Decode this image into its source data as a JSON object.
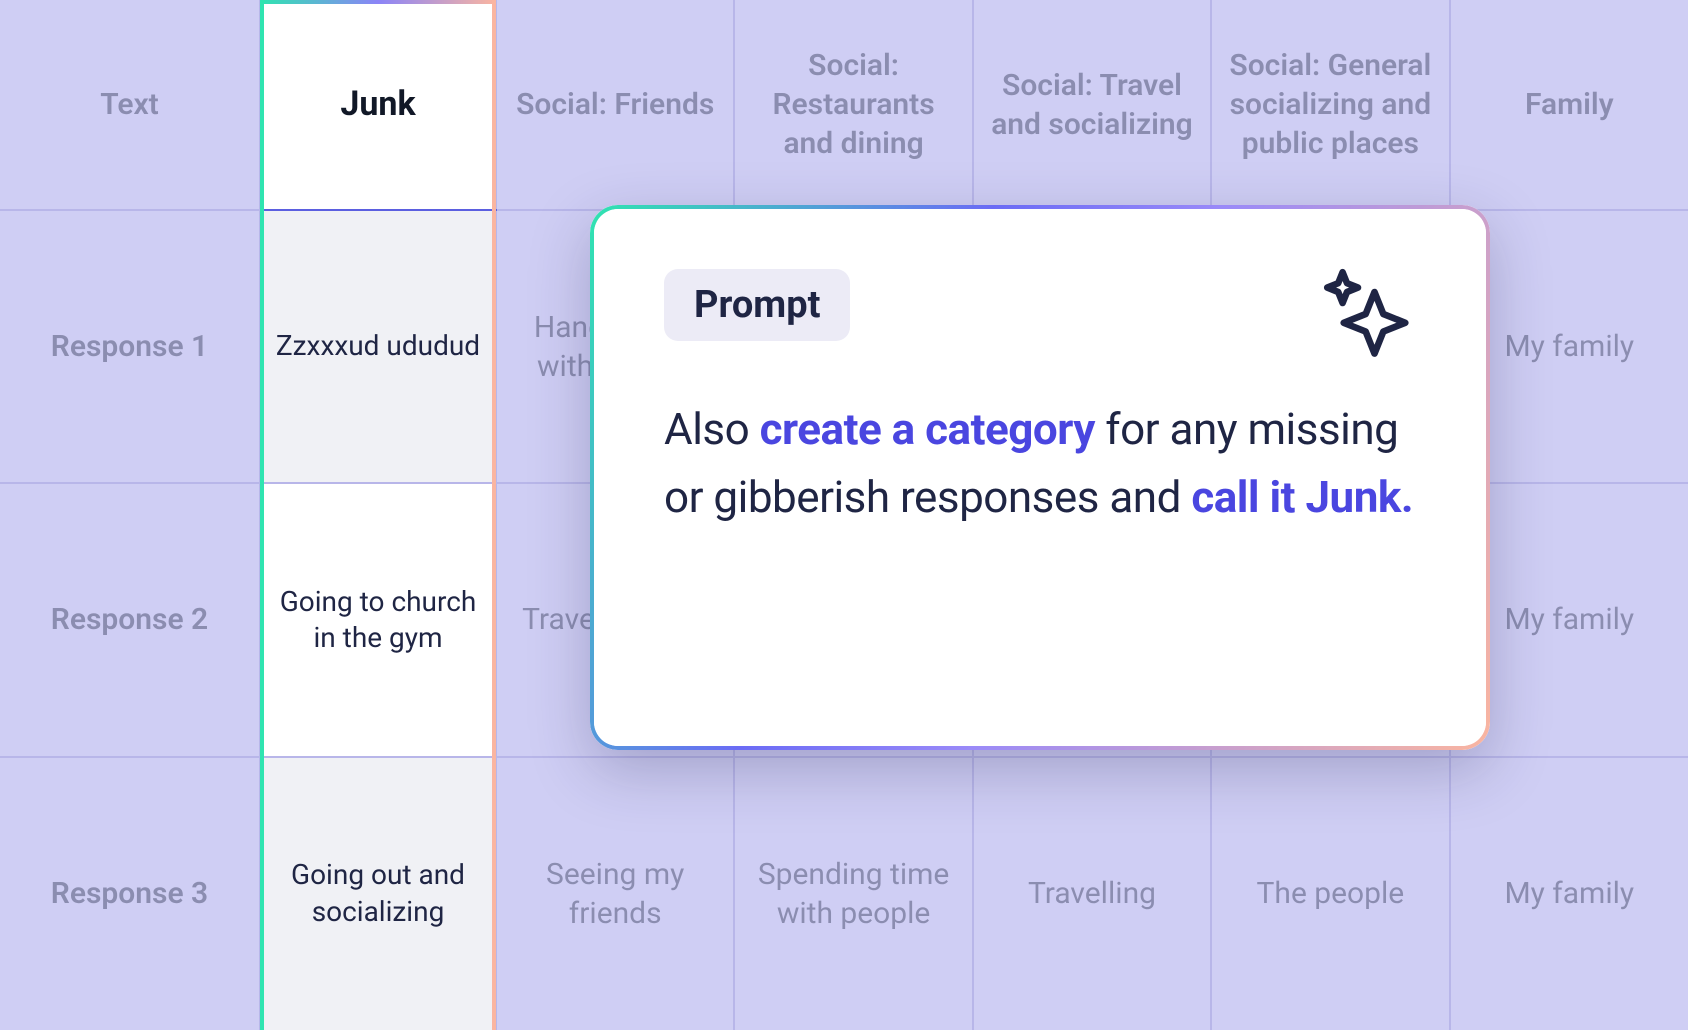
{
  "table": {
    "headers": [
      "Text",
      "Junk",
      "Social: Friends",
      "Social: Restaurants and dining",
      "Social: Travel and socializing",
      "Social: General socializing and public places",
      "Family"
    ],
    "rows": [
      {
        "label": "Response 1",
        "junk": "Zzxxxud ududud",
        "cells": [
          "Hanging out with friends",
          "",
          "",
          "",
          "My family"
        ]
      },
      {
        "label": "Response 2",
        "junk": "Going to church in the gym",
        "cells": [
          "Travel, friends",
          "",
          "",
          "",
          "My family"
        ]
      },
      {
        "label": "Response 3",
        "junk": "Going out and socializing",
        "cells": [
          "Seeing my friends",
          "Spending time with people",
          "Travelling",
          "The people",
          "My family"
        ]
      }
    ]
  },
  "card": {
    "badge": "Prompt",
    "text_parts": {
      "p0": "Also ",
      "p1": "create a category",
      "p2": " for any missing or gibberish responses and ",
      "p3": "call it Junk."
    }
  }
}
